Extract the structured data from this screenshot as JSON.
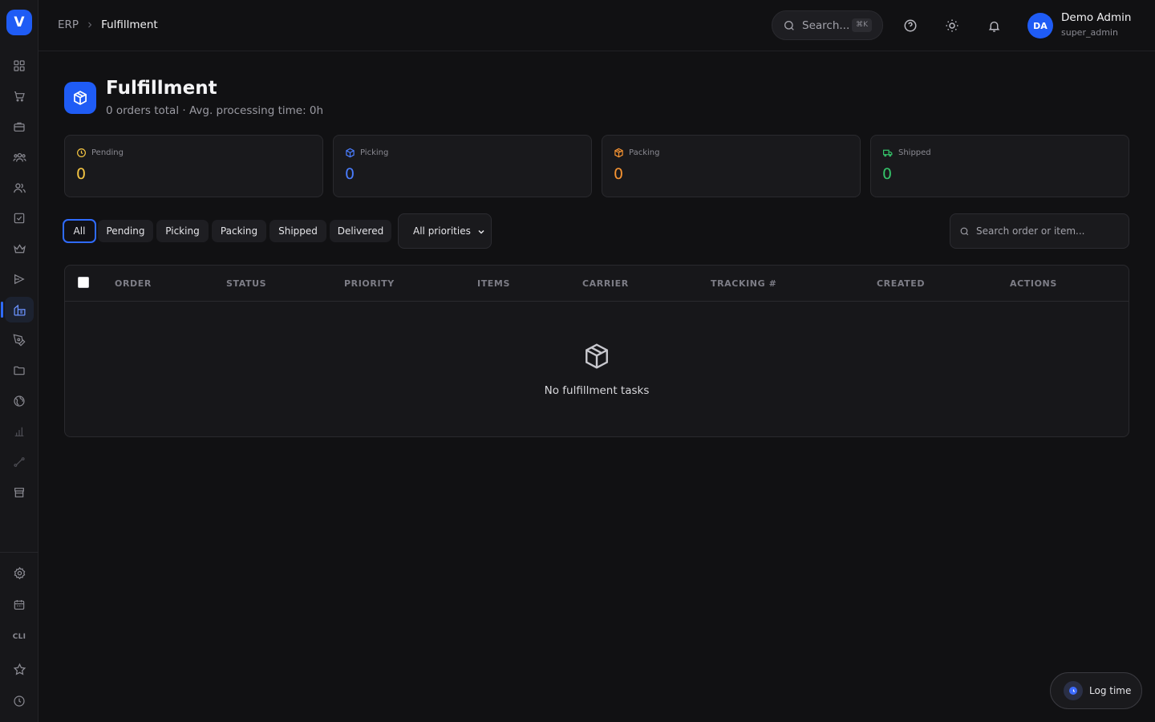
{
  "app": {
    "logo_letter": "V",
    "brand_color": "#1f5cf5"
  },
  "sidebar": {
    "items": [
      {
        "icon": "dashboard-grid-icon"
      },
      {
        "icon": "cart-icon"
      },
      {
        "icon": "briefcase-icon"
      },
      {
        "icon": "team-icon"
      },
      {
        "icon": "users-icon"
      },
      {
        "icon": "checkbox-icon"
      },
      {
        "icon": "crown-icon"
      },
      {
        "icon": "send-icon"
      },
      {
        "icon": "warehouse-icon",
        "active": true
      },
      {
        "icon": "pen-tool-icon"
      },
      {
        "icon": "folder-icon"
      },
      {
        "icon": "globe-icon"
      },
      {
        "icon": "bar-chart-icon",
        "dim": true
      },
      {
        "icon": "route-icon",
        "dim": true
      },
      {
        "icon": "store-icon"
      }
    ],
    "bottom_items": [
      {
        "icon": "settings-icon"
      },
      {
        "icon": "calendar-icon"
      },
      {
        "icon": "cli-icon",
        "label": "CLI"
      },
      {
        "icon": "star-icon"
      },
      {
        "icon": "clock-icon"
      }
    ]
  },
  "header": {
    "breadcrumb_root": "ERP",
    "breadcrumb_current": "Fulfillment",
    "search_placeholder": "Search...",
    "search_shortcut": "⌘K",
    "user": {
      "initials": "DA",
      "name": "Demo Admin",
      "role": "super_admin"
    }
  },
  "page": {
    "title": "Fulfillment",
    "subtitle": "0 orders total · Avg. processing time: 0h"
  },
  "stats": [
    {
      "label": "Pending",
      "value": "0",
      "color": "#f5c542",
      "icon": "clock-icon"
    },
    {
      "label": "Picking",
      "value": "0",
      "color": "#4a7dff",
      "icon": "box-icon"
    },
    {
      "label": "Packing",
      "value": "0",
      "color": "#f59332",
      "icon": "package-icon"
    },
    {
      "label": "Shipped",
      "value": "0",
      "color": "#35c46a",
      "icon": "truck-icon"
    }
  ],
  "filters": {
    "tabs": [
      "All",
      "Pending",
      "Picking",
      "Packing",
      "Shipped",
      "Delivered"
    ],
    "active": "All",
    "priority_selected": "All priorities",
    "search_placeholder": "Search order or item..."
  },
  "table": {
    "columns": [
      "ORDER",
      "STATUS",
      "PRIORITY",
      "ITEMS",
      "CARRIER",
      "TRACKING #",
      "CREATED",
      "ACTIONS"
    ],
    "rows": [],
    "empty_text": "No fulfillment tasks"
  },
  "log_time": {
    "label": "Log time"
  }
}
